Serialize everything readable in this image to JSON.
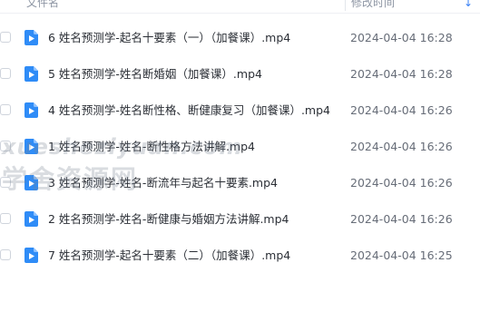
{
  "header": {
    "name_label": "文件名",
    "time_label": "修改时间",
    "sort_icon": "sort-down-arrow-icon",
    "sort_glyph": "↓"
  },
  "colors": {
    "file_icon": "#2f8cf7",
    "accent": "#3b82f6"
  },
  "files": [
    {
      "name": "6 姓名预测学-起名十要素（一）（加餐课）.mp4",
      "modified": "2024-04-04 16:28",
      "icon": "video-file-icon"
    },
    {
      "name": "5 姓名预测学-姓名断婚姻（加餐课）.mp4",
      "modified": "2024-04-04 16:28",
      "icon": "video-file-icon"
    },
    {
      "name": "4 姓名预测学-姓名断性格、断健康复习（加餐课）.mp4",
      "modified": "2024-04-04 16:26",
      "icon": "video-file-icon"
    },
    {
      "name": "1 姓名预测学-姓名-断性格方法讲解.mp4",
      "modified": "2024-04-04 16:26",
      "icon": "video-file-icon"
    },
    {
      "name": "3 姓名预测学-姓名-断流年与起名十要素.mp4",
      "modified": "2024-04-04 16:26",
      "icon": "video-file-icon"
    },
    {
      "name": "2 姓名预测学-姓名-断健康与婚姻方法讲解.mp4",
      "modified": "2024-04-04 16:26",
      "icon": "video-file-icon"
    },
    {
      "name": "7 姓名预测学-起名十要素（二）（加餐课）.mp4",
      "modified": "2024-04-04 16:25",
      "icon": "video-file-icon"
    }
  ],
  "watermark": {
    "line1": "xuesheziyuan.com",
    "line2": "学舍资源网"
  }
}
